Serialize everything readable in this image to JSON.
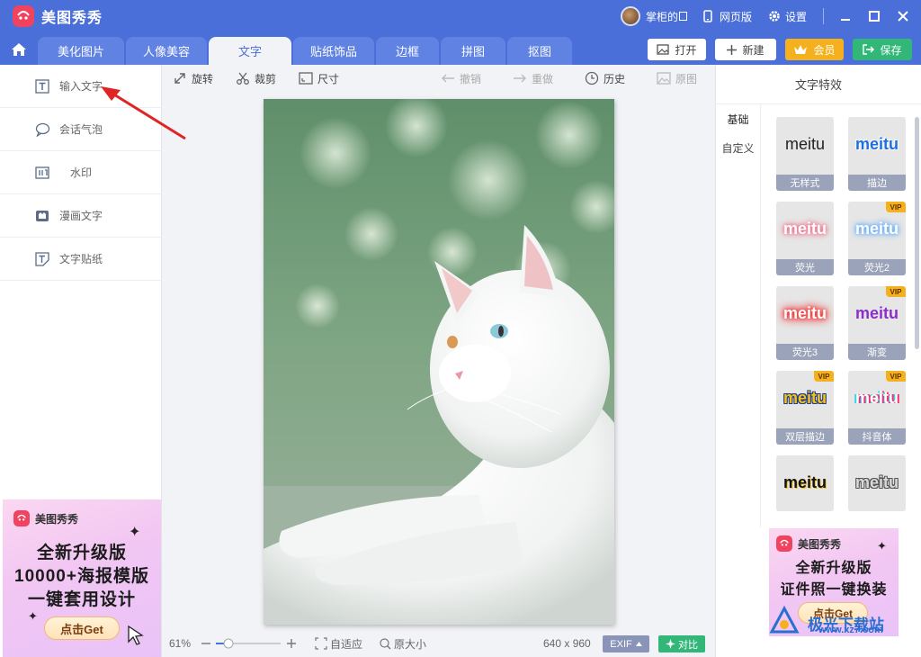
{
  "app": {
    "title": "美图秀秀",
    "user": "掌柜的",
    "web_version": "网页版",
    "settings": "设置"
  },
  "tabs": [
    {
      "label": "美化图片",
      "active": false
    },
    {
      "label": "人像美容",
      "active": false
    },
    {
      "label": "文字",
      "active": true
    },
    {
      "label": "贴纸饰品",
      "active": false
    },
    {
      "label": "边框",
      "active": false
    },
    {
      "label": "拼图",
      "active": false
    },
    {
      "label": "抠图",
      "active": false
    }
  ],
  "header_buttons": {
    "open": "打开",
    "new": "新建",
    "member": "会员",
    "save": "保存"
  },
  "left_menu": [
    {
      "label": "输入文字",
      "icon": "text-input-icon"
    },
    {
      "label": "会话气泡",
      "icon": "speech-bubble-icon"
    },
    {
      "label": "水印",
      "icon": "watermark-icon"
    },
    {
      "label": "漫画文字",
      "icon": "comic-text-icon"
    },
    {
      "label": "文字贴纸",
      "icon": "text-sticker-icon"
    }
  ],
  "left_ad": {
    "brand": "美图秀秀",
    "line1": "全新升级版",
    "line2": "10000+海报模版",
    "line3": "一键套用设计",
    "button": "点击Get"
  },
  "toolbar": {
    "rotate": "旋转",
    "crop": "裁剪",
    "size": "尺寸",
    "undo": "撤销",
    "redo": "重做",
    "history": "历史",
    "original": "原图"
  },
  "status": {
    "zoom": "61%",
    "fit": "自适应",
    "actual_size": "原大小",
    "dimensions": "640 x 960",
    "exif": "EXIF",
    "compare": "对比"
  },
  "right_panel": {
    "title": "文字特效",
    "tabs": [
      "基础",
      "自定义"
    ],
    "effects": [
      {
        "sample": "meitu",
        "label": "无样式",
        "vip": false
      },
      {
        "sample": "meitu",
        "label": "描边",
        "vip": false
      },
      {
        "sample": "meitu",
        "label": "荧光",
        "vip": false
      },
      {
        "sample": "meitu",
        "label": "荧光2",
        "vip": true
      },
      {
        "sample": "meitu",
        "label": "荧光3",
        "vip": false
      },
      {
        "sample": "meitu",
        "label": "渐变",
        "vip": true
      },
      {
        "sample": "meitu",
        "label": "双层描边",
        "vip": true
      },
      {
        "sample": "meitu",
        "label": "抖音体",
        "vip": true
      },
      {
        "sample": "meitu",
        "label": "",
        "vip": false
      },
      {
        "sample": "meitu",
        "label": "",
        "vip": false
      }
    ],
    "vip_badge": "VIP"
  },
  "right_ad": {
    "brand": "美图秀秀",
    "line1": "全新升级版",
    "line2": "证件照一键换装",
    "button": "点击Get"
  },
  "watermark": {
    "text": "极光下载站",
    "url": "www.xz7.com"
  }
}
